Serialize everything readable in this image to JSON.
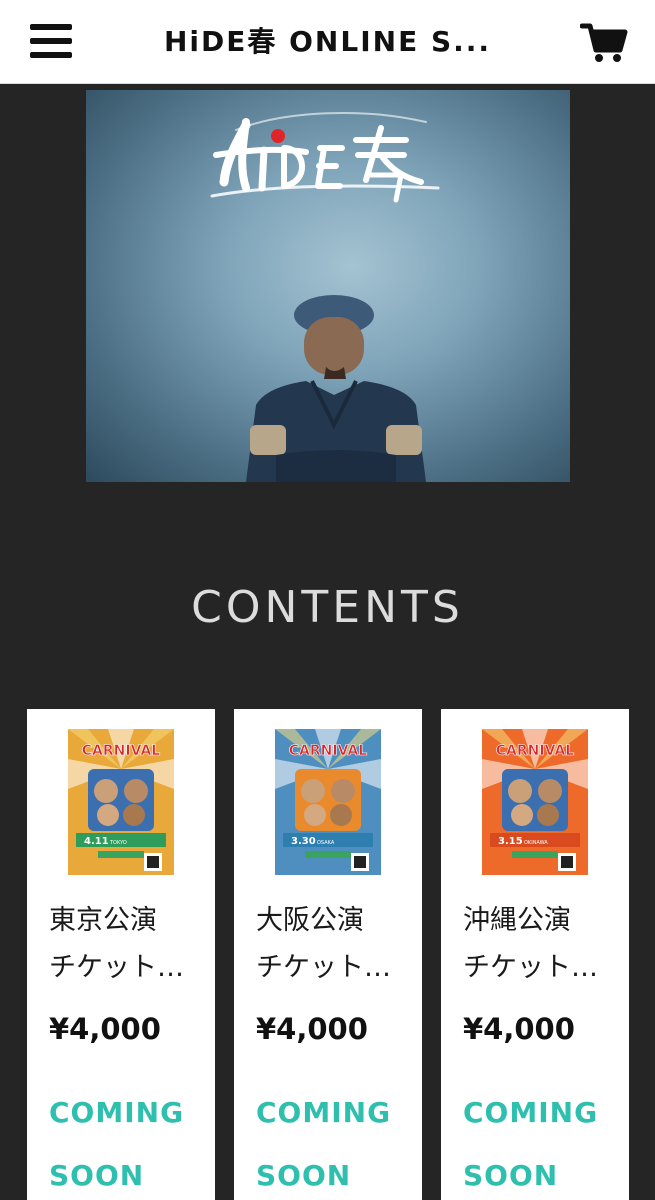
{
  "header": {
    "title": "HiDE春 ONLINE S...",
    "menu_icon": "hamburger-menu-icon",
    "cart_icon": "shopping-cart-icon"
  },
  "hero": {
    "logo_text": "HiDE春",
    "accent_color": "#e0252a"
  },
  "section": {
    "title": "CONTENTS"
  },
  "products": [
    {
      "name_line1": "東京公演",
      "name_line2": "チケット…",
      "price": "¥4,000",
      "status_line1": "COMING",
      "status_line2": "SOON",
      "poster_color": "#e9a83a",
      "poster_date": "4.11",
      "poster_venue": "TOKYO 代官山 二子玉川",
      "poster_title": "CARNIVAL"
    },
    {
      "name_line1": "大阪公演",
      "name_line2": "チケット…",
      "price": "¥4,000",
      "status_line1": "COMING",
      "status_line2": "SOON",
      "poster_color": "#4f8fc0",
      "poster_date": "3.30",
      "poster_venue": "OSAKA 西九条 Brand NEW",
      "poster_title": "CARNIVAL"
    },
    {
      "name_line1": "沖縄公演",
      "name_line2": "チケット…",
      "price": "¥4,000",
      "status_line1": "COMING",
      "status_line2": "SOON",
      "poster_color": "#ee6a2a",
      "poster_date": "3.15",
      "poster_venue": "OKINAWA 北谷 MOD'S",
      "poster_title": "CARNIVAL"
    }
  ],
  "colors": {
    "background": "#252525",
    "status_teal": "#2fbfae"
  }
}
